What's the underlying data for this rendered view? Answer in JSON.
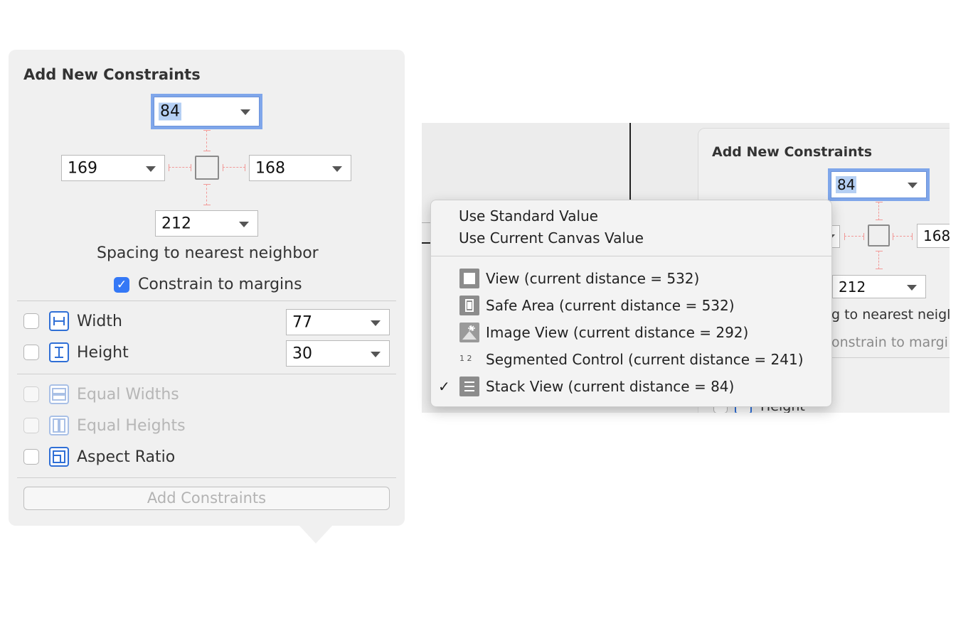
{
  "panel": {
    "title": "Add New Constraints",
    "top_value": "84",
    "left_value": "169",
    "right_value": "168",
    "bottom_value": "212",
    "spacing_caption": "Spacing to nearest neighbor",
    "constrain_label": "Constrain to margins",
    "constrain_checked": true,
    "width": {
      "label": "Width",
      "value": "77",
      "checked": false
    },
    "height": {
      "label": "Height",
      "value": "30",
      "checked": false
    },
    "equal_widths": {
      "label": "Equal Widths",
      "enabled": false
    },
    "equal_heights": {
      "label": "Equal Heights",
      "enabled": false
    },
    "aspect_ratio": {
      "label": "Aspect Ratio",
      "checked": false
    },
    "add_button": "Add Constraints"
  },
  "background_panel": {
    "title": "Add New Constraints",
    "top_value": "84",
    "right_value": "168",
    "bottom_value": "212",
    "caption_partial": "g to nearest neigl",
    "constrain_partial": "onstrain to margi",
    "height_partial": "Height"
  },
  "menu": {
    "standard": "Use Standard Value",
    "canvas": "Use Current Canvas Value",
    "items": [
      {
        "label": "View (current distance = 532)",
        "checked": false,
        "icon": "view-icon"
      },
      {
        "label": "Safe Area (current distance = 532)",
        "checked": false,
        "icon": "safe-area-icon"
      },
      {
        "label": "Image View (current distance = 292)",
        "checked": false,
        "icon": "image-view-icon"
      },
      {
        "label": "Segmented Control (current distance = 241)",
        "checked": false,
        "icon": "segmented-control-icon"
      },
      {
        "label": "Stack View (current distance = 84)",
        "checked": true,
        "icon": "stack-view-icon"
      }
    ],
    "checkmark": "✓",
    "segmented_glyph": "1 2"
  },
  "colors": {
    "accent": "#3478f6",
    "focus_ring": "#7fa6ea",
    "strut": "#f29a98"
  }
}
